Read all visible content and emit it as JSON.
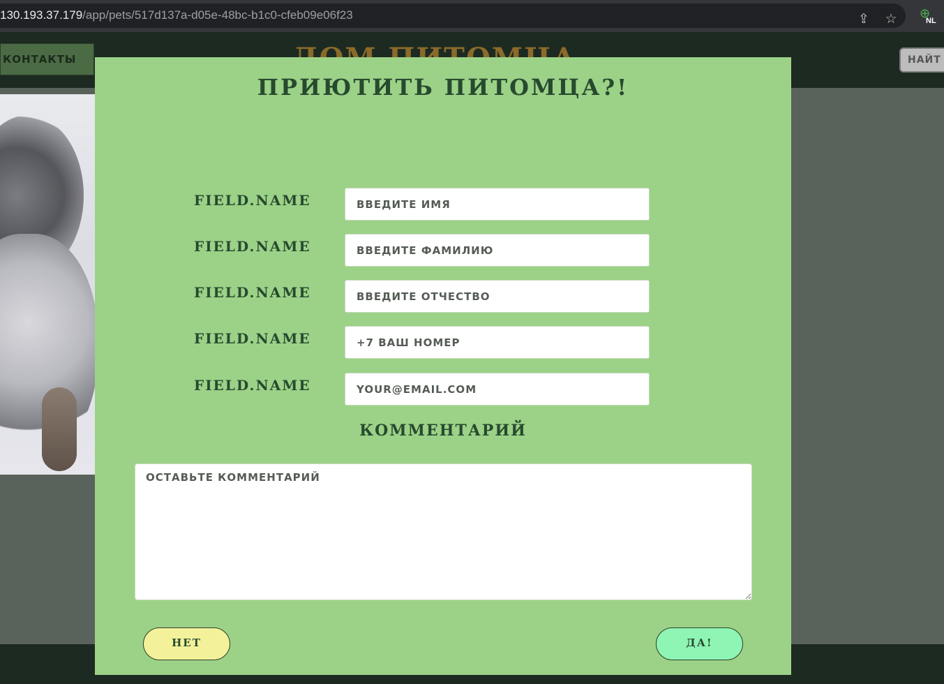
{
  "browser": {
    "url_host": "130.193.37.179",
    "url_path": "/app/pets/517d137a-d05e-48bc-b1c0-cfeb09e06f23",
    "icons": [
      "share-icon",
      "star-icon",
      "extension-globe-icon"
    ],
    "extension_badge": "NL"
  },
  "header": {
    "contacts_label": "КОНТАКТЫ",
    "site_title": "ДОМ ПИТОМЦА",
    "find_label": "НАЙТ"
  },
  "modal": {
    "title": "ПРИЮТИТЬ ПИТОМЦА?!",
    "fields": [
      {
        "label": "FIELD.NAME",
        "placeholder": "ВВЕДИТЕ ИМЯ",
        "value": ""
      },
      {
        "label": "FIELD.NAME",
        "placeholder": "ВВЕДИТЕ ФАМИЛИЮ",
        "value": ""
      },
      {
        "label": "FIELD.NAME",
        "placeholder": "ВВЕДИТЕ ОТЧЕСТВО",
        "value": ""
      },
      {
        "label": "FIELD.NAME",
        "placeholder": "+7 ВАШ НОМЕР",
        "value": ""
      },
      {
        "label": "FIELD.NAME",
        "placeholder": "YOUR@EMAIL.COM",
        "value": ""
      }
    ],
    "comment_label": "КОММЕНТАРИЙ",
    "comment_placeholder": "ОСТАВЬТЕ КОММЕНТАРИЙ",
    "no_label": "НЕТ",
    "yes_label": "ДА!"
  },
  "colors": {
    "modal_bg": "#9cd287",
    "text_dark_green": "#274a2f",
    "no_button": "#f3f19a",
    "yes_button": "#8ff5b4"
  }
}
